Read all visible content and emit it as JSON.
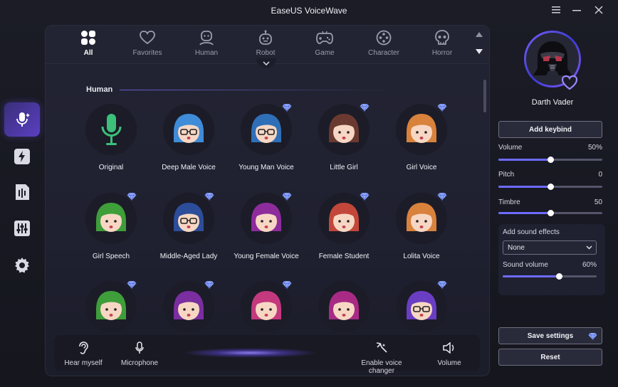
{
  "app": {
    "title": "EaseUS VoiceWave"
  },
  "tabs": [
    {
      "label": "All",
      "icon": "grid-icon",
      "active": true
    },
    {
      "label": "Favorites",
      "icon": "heart-icon"
    },
    {
      "label": "Human",
      "icon": "human-icon"
    },
    {
      "label": "Robot",
      "icon": "robot-icon"
    },
    {
      "label": "Game",
      "icon": "gamepad-icon"
    },
    {
      "label": "Character",
      "icon": "character-icon"
    },
    {
      "label": "Horror",
      "icon": "skull-icon"
    }
  ],
  "section": {
    "title": "Human"
  },
  "voices": [
    {
      "name": "Original",
      "premium": false,
      "avatar": "microphone-avatar"
    },
    {
      "name": "Deep Male Voice",
      "premium": false,
      "avatar": "deep-male-avatar"
    },
    {
      "name": "Young Man Voice",
      "premium": true,
      "avatar": "young-man-avatar"
    },
    {
      "name": "Little Girl",
      "premium": true,
      "avatar": "little-girl-avatar"
    },
    {
      "name": "Girl Voice",
      "premium": true,
      "avatar": "girl-avatar"
    },
    {
      "name": "Girl Speech",
      "premium": true,
      "avatar": "girl-speech-avatar"
    },
    {
      "name": "Middle-Aged Lady",
      "premium": true,
      "avatar": "middle-aged-lady-avatar"
    },
    {
      "name": "Young Female Voice",
      "premium": true,
      "avatar": "young-female-avatar"
    },
    {
      "name": "Female Student",
      "premium": true,
      "avatar": "female-student-avatar"
    },
    {
      "name": "Lolita Voice",
      "premium": true,
      "avatar": "lolita-avatar"
    },
    {
      "name": "",
      "premium": true,
      "avatar": "green-hair-avatar"
    },
    {
      "name": "",
      "premium": true,
      "avatar": "purple-hair-avatar"
    },
    {
      "name": "",
      "premium": true,
      "avatar": "pink-buns-avatar"
    },
    {
      "name": "",
      "premium": false,
      "avatar": "pink-hair-avatar"
    },
    {
      "name": "",
      "premium": true,
      "avatar": "glasses-boy-avatar"
    }
  ],
  "bottom": {
    "hear_myself": "Hear myself",
    "microphone": "Microphone",
    "enable_changer": "Enable voice changer",
    "volume": "Volume"
  },
  "right": {
    "selected_voice": "Darth Vader",
    "add_keybind": "Add keybind",
    "volume": {
      "label": "Volume",
      "value": "50%",
      "level": 0.5
    },
    "pitch": {
      "label": "Pitch",
      "value": "0",
      "level": 0.5
    },
    "timbre": {
      "label": "Timbre",
      "value": "50",
      "level": 0.5
    },
    "sound_effects": {
      "label": "Add sound effects",
      "selected": "None"
    },
    "sound_volume": {
      "label": "Sound volume",
      "value": "60%",
      "level": 0.6
    },
    "save_settings": "Save settings",
    "reset": "Reset"
  },
  "colors": {
    "accent": "#6e6bff",
    "gem": "#8fa8ff",
    "active_tab": "#5b3fc2"
  }
}
